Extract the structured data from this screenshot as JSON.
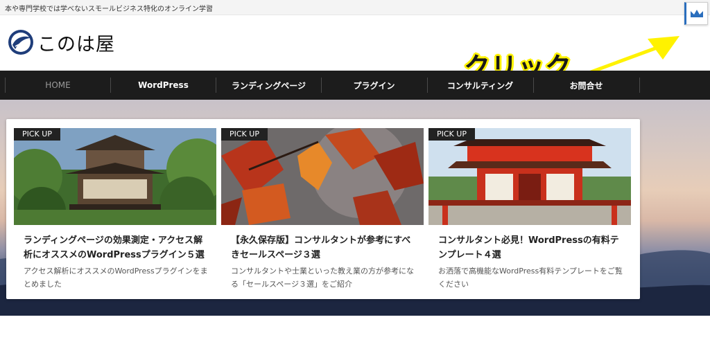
{
  "topbar": {
    "tagline": "本や専門学校では学べないスモールビジネス特化のオンライン学習"
  },
  "header": {
    "site_name": "このは屋",
    "annotation": "クリック"
  },
  "colors": {
    "accent": "#2a6ebd",
    "nav_bg": "#1c1c1c",
    "badge_bg": "#222222",
    "annotation": "#fff200"
  },
  "icons": {
    "crown": "crown-icon",
    "logo": "leaf-logo-icon"
  },
  "nav": [
    {
      "label": "HOME"
    },
    {
      "label": "WordPress"
    },
    {
      "label": "ランディングページ"
    },
    {
      "label": "プラグイン"
    },
    {
      "label": "コンサルティング"
    },
    {
      "label": "お問合せ"
    }
  ],
  "cards": [
    {
      "badge": "PICK UP",
      "title": "ランディングページの効果測定・アクセス解析にオススメのWordPressプラグイン５選",
      "excerpt": "アクセス解析にオススメのWordPressプラグインをまとめました"
    },
    {
      "badge": "PICK UP",
      "title": "【永久保存版】コンサルタントが参考にすべきセールスページ３選",
      "excerpt": "コンサルタントや士業といった教え業の方が参考になる「セールスページ３選」をご紹介"
    },
    {
      "badge": "PICK UP",
      "title": "コンサルタント必見！WordPressの有料テンプレート４選",
      "excerpt": "お洒落で高機能なWordPress有料テンプレートをご覧ください"
    }
  ]
}
